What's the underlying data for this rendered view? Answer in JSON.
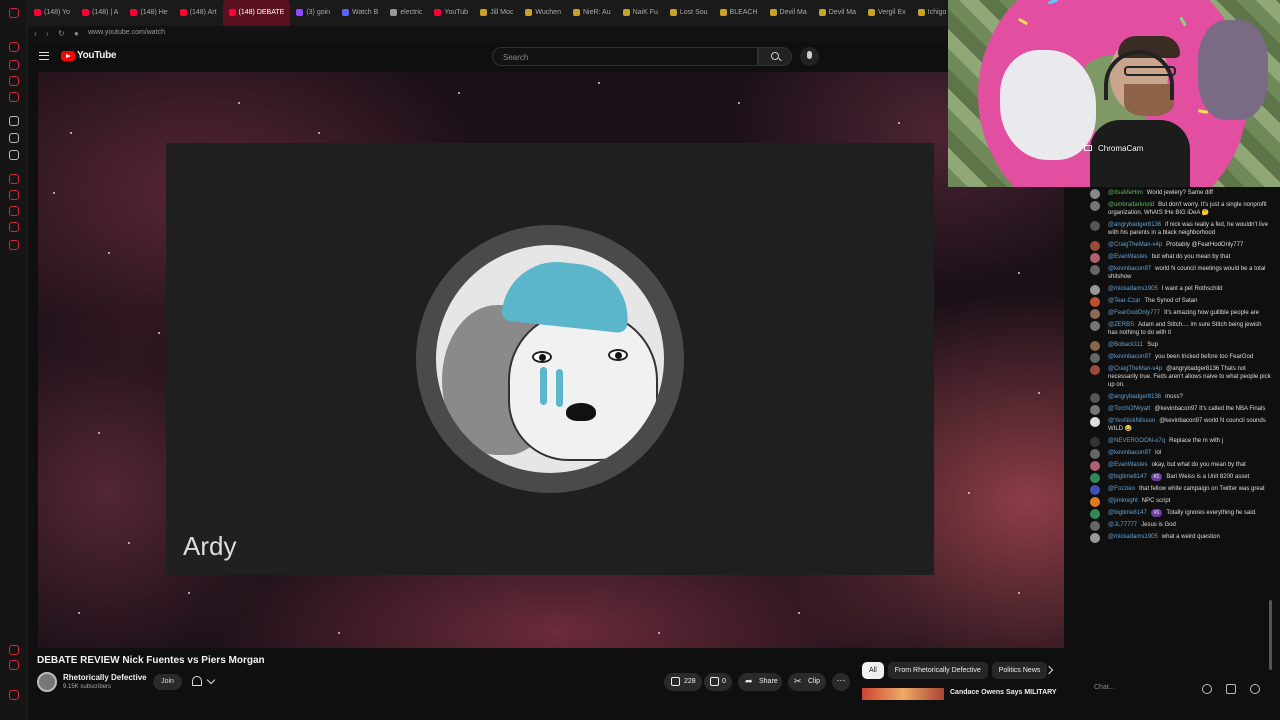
{
  "browser": {
    "tabs": [
      {
        "label": "(148) Yo",
        "color": "#ff0033"
      },
      {
        "label": "(148) | A",
        "color": "#ff0033"
      },
      {
        "label": "(148) He",
        "color": "#ff0033"
      },
      {
        "label": "(148) Art",
        "color": "#ff0033"
      },
      {
        "label": "(148) DEBATE",
        "color": "#ff0033",
        "active": true
      },
      {
        "label": "(3) goin",
        "color": "#9146ff"
      },
      {
        "label": "Watch B",
        "color": "#5865f2"
      },
      {
        "label": "electric",
        "color": "#999999"
      },
      {
        "label": "YouTub",
        "color": "#ff0033"
      },
      {
        "label": "Jill Moc",
        "color": "#c9a227"
      },
      {
        "label": "Wuchen",
        "color": "#c9a227"
      },
      {
        "label": "NieR: Au",
        "color": "#c9a227"
      },
      {
        "label": "NaiK Fu",
        "color": "#c9a227"
      },
      {
        "label": "Lost Sou",
        "color": "#c9a227"
      },
      {
        "label": "BLEACH",
        "color": "#c9a227"
      },
      {
        "label": "Devil Ma",
        "color": "#c9a227"
      },
      {
        "label": "Devil Ma",
        "color": "#c9a227"
      },
      {
        "label": "Vergil Ex",
        "color": "#c9a227"
      },
      {
        "label": "Ichigo",
        "color": "#c9a227"
      }
    ],
    "url": "www.youtube.com/watch"
  },
  "header": {
    "logo_text": "YouTube",
    "search_placeholder": "Search"
  },
  "video": {
    "label": "Ardy",
    "title": "DEBATE REVIEW Nick Fuentes vs Piers Morgan"
  },
  "channel": {
    "name": "Rhetorically Defective",
    "subscribers": "9.15K subscribers",
    "join_label": "Join"
  },
  "actions": {
    "likes": "228",
    "dislikes": "0",
    "share": "Share",
    "clip": "Clip",
    "more": "⋯"
  },
  "chips": [
    "All",
    "From Rhetorically Defective",
    "Politics News"
  ],
  "recommendation": {
    "title": "Candace Owens Says MILITARY"
  },
  "cam": {
    "label": "ChromaCam"
  },
  "chat": {
    "placeholder": "Chat...",
    "messages": [
      {
        "user": "@ItsaMeHim",
        "text": "World jewlery? Same diff",
        "color": "#888888",
        "green": true
      },
      {
        "user": "@umbradarknold",
        "text": "But don't worry. It's just a single nonprofit organization. WhAtS tHe BIG iDeA 🤔",
        "color": "#777777",
        "green": true
      },
      {
        "user": "@angrybadger8136",
        "text": "if nick was really a fed, he wouldn't live with his parents in a black neighborhood",
        "color": "#555555"
      },
      {
        "user": "@CraigTheMan-v4p",
        "text": "Probably @FearHodOnly777",
        "color": "#9a4b3a"
      },
      {
        "user": "@EvanWastes",
        "text": "but what do you mean by that",
        "color": "#b06070"
      },
      {
        "user": "@kevinbacon97",
        "text": "world N council meetings would be a total shitshow",
        "color": "#666666"
      },
      {
        "user": "@mickadams1905",
        "text": "I want a pet Rothschild",
        "color": "#999999"
      },
      {
        "user": "@Tear-Czar",
        "text": "The Synod of Satan",
        "color": "#c0502a"
      },
      {
        "user": "@FearGodOnly777",
        "text": "It's amazing how gullible people are",
        "color": "#8a6a5a"
      },
      {
        "user": "@ZERBS",
        "text": "Adam and Stitch.... im sure Stitch being jewish has nothing to do with it",
        "color": "#777777"
      },
      {
        "user": "@Boback111",
        "text": "Sup",
        "color": "#886644"
      },
      {
        "user": "@kevinbacon97",
        "text": "you been tricked before too FearGod",
        "color": "#666666"
      },
      {
        "user": "@CraigTheMan-v4p",
        "text": "@angrybadger8136 Thats not necessarily true. Feds aren't allows naive to what people pick up on.",
        "color": "#9a4b3a"
      },
      {
        "user": "@angrybadger8136",
        "text": "moss?",
        "color": "#555555"
      },
      {
        "user": "@TorchOfWyatt",
        "text": "@kevinbacon97 It's called the NBA Finals",
        "color": "#777777"
      },
      {
        "user": "@YesNickNilsson",
        "text": "@kevinbacon97 world N council sounds WILD 😂",
        "color": "#dddddd"
      },
      {
        "user": "@NEVERGOON-o7q",
        "text": "Replace the m with j",
        "color": "#333333"
      },
      {
        "user": "@kevinbacon97",
        "text": "lol",
        "color": "#666666"
      },
      {
        "user": "@EvanWastes",
        "text": "okay, but what do you mean by that",
        "color": "#b06070"
      },
      {
        "user": "@bigtime8147",
        "text": "Bari Weiss is a Unit 8200 asset",
        "color": "#2e8b57",
        "badge": "#1"
      },
      {
        "user": "@Fozzieo",
        "text": "that fellow white campaign on Twitter was great",
        "color": "#3f51b5"
      },
      {
        "user": "@jimknight",
        "text": "NPC script",
        "color": "#e07b20"
      },
      {
        "user": "@bigtime8147",
        "text": "Totally ignores everything he said.",
        "color": "#2e8b57",
        "badge": "#1"
      },
      {
        "user": "@JL77777",
        "text": "Jesus is God",
        "color": "#666666"
      },
      {
        "user": "@mickadams1905",
        "text": "what a weird question",
        "color": "#999999"
      }
    ]
  }
}
